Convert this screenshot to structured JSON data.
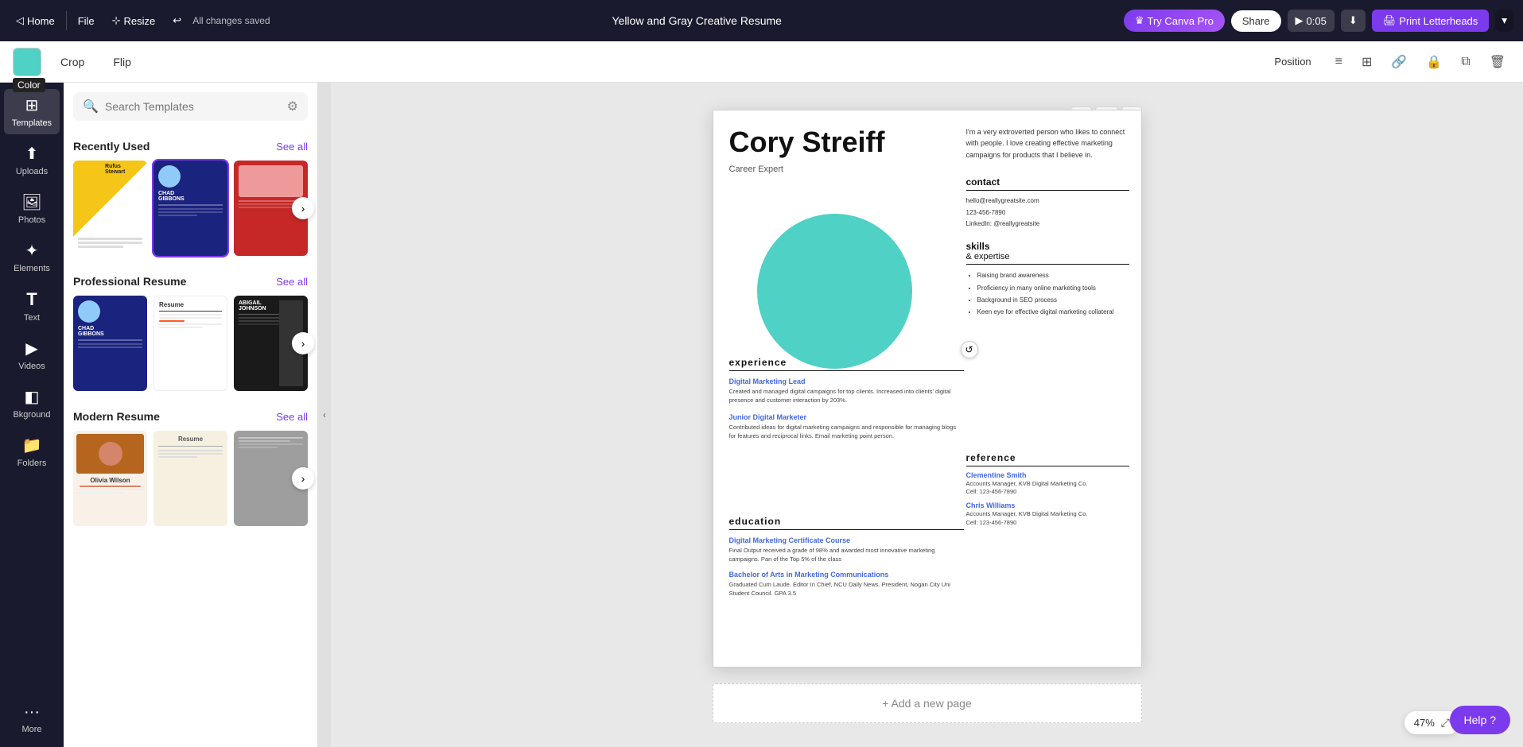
{
  "topbar": {
    "home_label": "Home",
    "file_label": "File",
    "resize_label": "Resize",
    "saved_text": "All changes saved",
    "doc_title": "Yellow and Gray Creative Resume",
    "try_pro_label": "Try Canva Pro",
    "share_label": "Share",
    "timer": "0:05",
    "print_label": "Print Letterheads"
  },
  "secondbar": {
    "color_label": "Color",
    "crop_label": "Crop",
    "flip_label": "Flip",
    "position_label": "Position"
  },
  "sidebar": {
    "items": [
      {
        "id": "templates",
        "label": "Templates",
        "icon": "⊞"
      },
      {
        "id": "uploads",
        "label": "Uploads",
        "icon": "⬆"
      },
      {
        "id": "photos",
        "label": "Photos",
        "icon": "🖼"
      },
      {
        "id": "elements",
        "label": "Elements",
        "icon": "✦"
      },
      {
        "id": "text",
        "label": "Text",
        "icon": "T"
      },
      {
        "id": "videos",
        "label": "Videos",
        "icon": "▶"
      },
      {
        "id": "background",
        "label": "Bkground",
        "icon": "🎨"
      },
      {
        "id": "folders",
        "label": "Folders",
        "icon": "📁"
      },
      {
        "id": "more",
        "label": "More",
        "icon": "···"
      }
    ]
  },
  "templates_panel": {
    "search_placeholder": "Search Templates",
    "sections": [
      {
        "id": "recently-used",
        "title": "Recently Used",
        "see_all": "See all",
        "templates": [
          {
            "id": "rufus",
            "name": "Rufus Stewart",
            "style": "yellow"
          },
          {
            "id": "chad1",
            "name": "Chad Gibbons",
            "style": "blue"
          },
          {
            "id": "red",
            "name": "",
            "style": "red"
          }
        ]
      },
      {
        "id": "professional-resume",
        "title": "Professional Resume",
        "see_all": "See all",
        "templates": [
          {
            "id": "chad2",
            "name": "Chad Gibbons",
            "style": "blue2"
          },
          {
            "id": "white",
            "name": "",
            "style": "white"
          },
          {
            "id": "dark",
            "name": "Abigail Johnson",
            "style": "dark"
          }
        ]
      },
      {
        "id": "modern-resume",
        "title": "Modern Resume",
        "see_all": "See all",
        "templates": [
          {
            "id": "olivia",
            "name": "Olivia Wilson",
            "style": "olivia"
          },
          {
            "id": "beige",
            "name": "",
            "style": "beige"
          },
          {
            "id": "gray",
            "name": "",
            "style": "gray"
          }
        ]
      }
    ]
  },
  "canvas": {
    "resume": {
      "name": "Cory Streiff",
      "title": "Career Expert",
      "bio": "I'm a very extroverted person who likes to connect with people. I love creating effective marketing campaigns for products that I believe in.",
      "contact": {
        "title": "contact",
        "email": "hello@reallygreatsite.com",
        "phone": "123-456-7890",
        "linkedin": "LinkedIn: @reallygreatsite"
      },
      "skills": {
        "title": "skills",
        "subtitle": "& expertise",
        "items": [
          "Raising brand awareness",
          "Proficiency in many online marketing tools",
          "Background in SEO process",
          "Keen eye for effective digital marketing collateral"
        ]
      },
      "experience": {
        "title": "experience",
        "jobs": [
          {
            "role": "Digital Marketing Lead",
            "desc": "Created and managed digital campaigns for top clients. Increased into clients' digital presence and customer interaction by 203%."
          },
          {
            "role": "Junior Digital Marketer",
            "desc": "Contributed ideas for digital marketing campaigns and responsible for managing blogs for features and reciprocal links. Email marketing point person."
          }
        ]
      },
      "education": {
        "title": "education",
        "items": [
          {
            "degree": "Digital Marketing Certificate Course",
            "detail": "Final Output received a grade of 98% and awarded most innovative marketing campaigns. Pan of the Top 5% of the class"
          },
          {
            "degree": "Bachelor of Arts in Marketing Communications",
            "detail": "Graduated Cum Laude. Editor In Chief, NCU Daily News. President, Nogan City Uni Student Council. GPA 3.5"
          }
        ]
      },
      "reference": {
        "title": "reference",
        "refs": [
          {
            "name": "Clementine Smith",
            "role": "Accounts Manager, KVB Digital Marketing Co.",
            "cell": "Cell: 123-456-7890"
          },
          {
            "name": "Chris Williams",
            "role": "Accounts Manager, KVB Digital Marketing Co.",
            "cell": "Cell: 123-456-7890"
          }
        ]
      }
    },
    "add_page_label": "+ Add a new page",
    "zoom_level": "47%"
  },
  "help_label": "Help ?",
  "icons": {
    "home": "◁",
    "undo": "↩",
    "crown": "♛",
    "play": "▶",
    "download": "⬇",
    "print": "🖨",
    "search": "🔍",
    "filter": "⚙",
    "chevron_right": "›",
    "chevron_left": "‹",
    "gear": "⚙",
    "link": "🔗",
    "lock": "🔒",
    "copy": "⧉",
    "trash": "🗑",
    "refresh": "↺",
    "add": "+",
    "more_dots": "···"
  }
}
